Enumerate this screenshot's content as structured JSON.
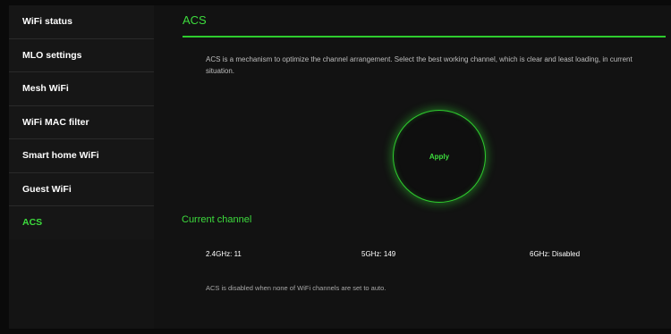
{
  "sidebar": {
    "items": [
      {
        "label": "WiFi status"
      },
      {
        "label": "MLO settings"
      },
      {
        "label": "Mesh WiFi"
      },
      {
        "label": "WiFi MAC filter"
      },
      {
        "label": "Smart home WiFi"
      },
      {
        "label": "Guest WiFi"
      },
      {
        "label": "ACS"
      }
    ],
    "active": "ACS"
  },
  "main": {
    "title": "ACS",
    "description": "ACS is a mechanism to optimize the channel arrangement. Select the best working channel, which is clear and least loading, in current situation.",
    "apply_label": "Apply",
    "current_channel": {
      "heading": "Current channel",
      "band_24": "2.4GHz: 11",
      "band_5": "5GHz: 149",
      "band_6": "6GHz: Disabled"
    },
    "note": "ACS is disabled when none of WiFi channels are set to auto."
  },
  "colors": {
    "accent": "#3ddc3d",
    "background": "#0a0a0a",
    "panel": "#121212"
  }
}
